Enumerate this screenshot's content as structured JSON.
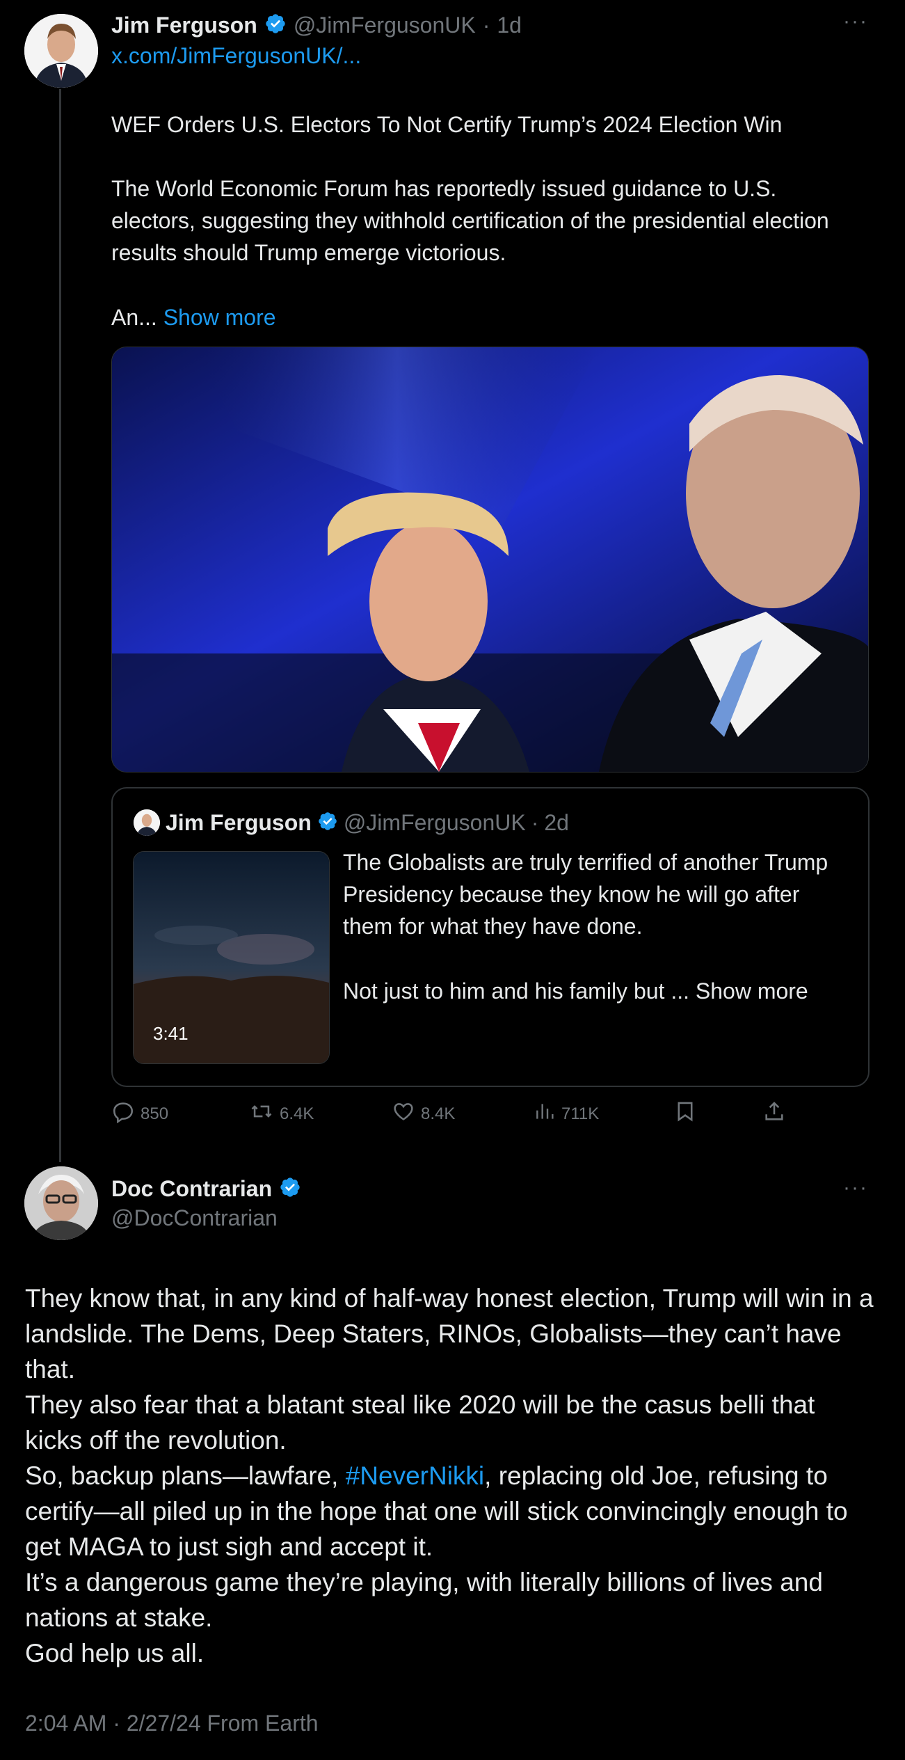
{
  "parent": {
    "author_name": "Jim Ferguson",
    "handle": "@JimFergusonUK",
    "dot": "·",
    "time": "1d",
    "link": "x.com/JimFergusonUK/...",
    "headline": "WEF Orders U.S. Electors To Not Certify Trump’s 2024 Election Win",
    "body": "The World Economic Forum has reportedly issued guidance to U.S. electors, suggesting they withhold certification of the presidential election results should Trump emerge victorious.",
    "truncated": "An...",
    "show_more": "Show more"
  },
  "quote": {
    "author_name": "Jim Ferguson",
    "handle": "@JimFergusonUK",
    "dot": "·",
    "time": "2d",
    "text1": "The Globalists are truly terrified of another Trump Presidency because they know he will go after them for what they have done.",
    "text2_prefix": "Not just to him and his family but ...",
    "show_more": "Show more",
    "video_duration": "3:41"
  },
  "actions": {
    "replies": "850",
    "reposts": "6.4K",
    "likes": "8.4K",
    "views": "711K"
  },
  "reply": {
    "author_name": "Doc Contrarian",
    "handle": "@DocContrarian",
    "p1": "They know that, in any kind of half-way honest election, Trump will win in a landslide. The Dems, Deep Staters, RINOs, Globalists—they can’t have that.",
    "p2": "They also fear that a blatant steal like 2020 will be the casus belli that kicks off the revolution.",
    "p3_before": "So, backup plans—lawfare, ",
    "p3_hashtag": "#NeverNikki",
    "p3_after": ", replacing old Joe, refusing to certify—all piled up in the hope that one will stick convincingly enough to get MAGA to just sigh and accept it.",
    "p4": "It’s a dangerous game they’re playing, with literally billions of lives and nations at stake.",
    "p5": "God help us all.",
    "timestamp": "2:04 AM · 2/27/24 From Earth"
  },
  "colors": {
    "background": "#000000",
    "text": "#e7e9ea",
    "muted": "#71767b",
    "link": "#1d9bf0",
    "verified": "#1d9bf0"
  },
  "icons": {
    "more": "more-icon",
    "verified": "verified-badge-icon",
    "reply": "reply-icon",
    "repost": "repost-icon",
    "like": "like-icon",
    "views": "views-icon",
    "bookmark": "bookmark-icon",
    "share": "share-icon"
  },
  "more_glyph": "···"
}
